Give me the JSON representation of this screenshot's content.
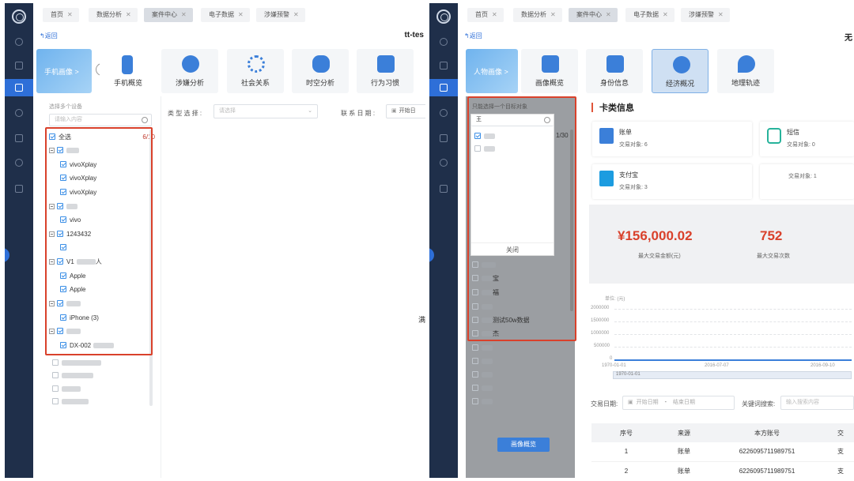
{
  "left": {
    "tabs": [
      "首页",
      "数据分析",
      "案件中心",
      "电子数据",
      "涉嫌预警"
    ],
    "active_tab": 2,
    "back_label": "返回",
    "case_title": "tt-tes",
    "main_card_label": "手机画像 >",
    "features": [
      "手机概览",
      "涉嫌分析",
      "社会关系",
      "时空分析",
      "行为习惯"
    ],
    "filter_hint": "选择多个设备",
    "search_placeholder": "请输入内容",
    "select_all_label": "全选",
    "selected_count": "6/10",
    "tree": {
      "devices": [
        {
          "children": [
            "vivoXplay",
            "vivoXplay",
            "vivoXplay"
          ]
        },
        {
          "children": [
            "vivo"
          ]
        },
        {
          "label": "1243432",
          "children": [
            ""
          ]
        },
        {
          "label": "V1",
          "label_suffix": "人",
          "children": [
            "Apple",
            "Apple"
          ]
        },
        {
          "children": [
            "iPhone (3)"
          ]
        },
        {
          "children": [
            "DX-002"
          ]
        }
      ]
    },
    "type_select_label": "类 型 选 择 :",
    "type_select_placeholder": "请选择",
    "date_label": "联 系 日 期 :",
    "date_start_placeholder": "开始日",
    "side_letter": "满"
  },
  "right": {
    "tabs": [
      "首页",
      "数据分析",
      "案件中心",
      "电子数据",
      "涉嫌预警"
    ],
    "active_tab": 2,
    "back_label": "返回",
    "case_title": "无",
    "main_card_label": "人物画像 >",
    "features": [
      "画像概览",
      "身份信息",
      "经济概况",
      "地理轨迹"
    ],
    "selected_feature": 2,
    "filter_hint": "只能选择一个目标对象",
    "search_value": "王",
    "popup_count": "1/30",
    "close_label": "关闭",
    "list_items": [
      "宝",
      "福",
      "测试50w数据",
      "杰"
    ],
    "bottom_button": "画像概览",
    "section_title": "卡类信息",
    "cards": [
      {
        "title": "账单",
        "sub": "交易对象:",
        "value": "6"
      },
      {
        "title": "短信",
        "sub": "交易对象:",
        "value": "0"
      },
      {
        "title": "支付宝",
        "sub": "交易对象:",
        "value": "3"
      },
      {
        "title": "",
        "sub": "交易对象:",
        "value": "1"
      }
    ],
    "stats": [
      {
        "value": "¥156,000.02",
        "label": "最大交易金额(元)"
      },
      {
        "value": "752",
        "label": "最大交易次数"
      }
    ],
    "chart": {
      "unit_label": "单位: (元)",
      "y_ticks": [
        "2000000",
        "1500000",
        "1000000",
        "500000",
        "0"
      ],
      "x_ticks": [
        "1970-01-01",
        "2016-07-07",
        "2016-09-10"
      ],
      "brush_label": "1970-01-01"
    },
    "date_filter_label": "交易日期:",
    "date_start": "开始日期",
    "date_end": "结束日期",
    "date_sep": "-",
    "keyword_label": "关键词搜索:",
    "keyword_placeholder": "输入搜索内容",
    "table": {
      "headers": [
        "序号",
        "来源",
        "本方账号",
        "交"
      ],
      "rows": [
        [
          "1",
          "账单",
          "6226095711989751",
          "支"
        ],
        [
          "2",
          "账单",
          "6226095711989751",
          "支"
        ]
      ]
    }
  },
  "colors": {
    "sidebar": "#1f2f4a",
    "accent": "#2e6fd8",
    "highlight": "#d9412b"
  }
}
